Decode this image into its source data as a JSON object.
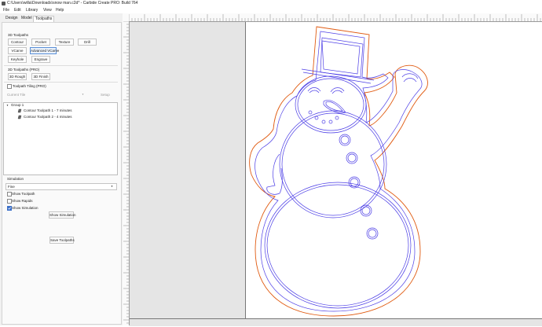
{
  "window": {
    "title": "C:\\Users\\willa\\Downloads\\snow man.c2d* - Carbide Create PRO: Build 764"
  },
  "menu": {
    "file": "File",
    "edit": "Edit",
    "library": "Library",
    "view": "View",
    "help": "Help"
  },
  "tabs": {
    "design": "Design",
    "model": "Model",
    "toolpaths": "Toolpaths"
  },
  "toolpaths_3d": {
    "header": "3D Toolpaths",
    "contour": "Contour",
    "pocket": "Pocket",
    "texture": "Texture",
    "drill": "Drill",
    "vcarve": "VCarve",
    "advanced_vcarve": "Advanced VCarve",
    "keyhole": "Keyhole",
    "engrave": "Engrave"
  },
  "toolpaths_pro": {
    "header": "3D Toolpaths (PRO)",
    "rough": "3D Rough",
    "finish": "3D Finish"
  },
  "tiling": {
    "label": "Toolpath Tiling (PRO)",
    "current_tile": "Current Tile",
    "setup": "Setup"
  },
  "toolpath_list": {
    "group": "Group 1",
    "items": [
      {
        "label": "Contour Toolpath 1 - 7 minutes"
      },
      {
        "label": "Contour Toolpath 2 - 4 minutes"
      }
    ]
  },
  "simulation": {
    "header": "Simulation",
    "quality": "Fine",
    "show_toolpath": "Show Toolpath",
    "show_rapids": "Show Rapids",
    "show_simulation": "Show Simulation",
    "show_simulation_button": "Show Simulation",
    "save_toolpaths": "Save Toolpaths"
  },
  "colors": {
    "outer_contour": "#e05a10",
    "inner_contour": "#4c3ee6",
    "stock": "#e5e5e5",
    "accent": "#3b6fc8"
  },
  "icons": [
    "app-icon",
    "toolpath-icon",
    "chevron-down-icon",
    "check-icon"
  ]
}
